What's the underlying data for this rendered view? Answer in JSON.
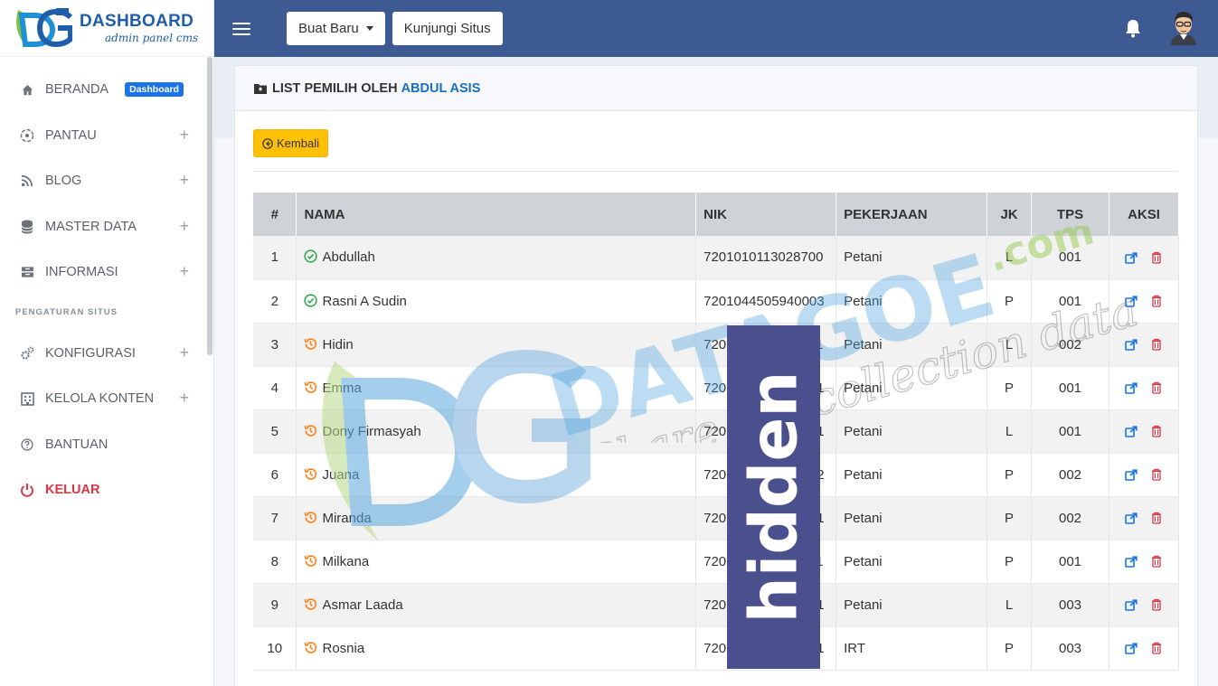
{
  "brand": {
    "title": "DASHBOARD",
    "subtitle": "admin panel cms"
  },
  "sidebar": {
    "items": [
      {
        "label": "BERANDA",
        "badge": "Dashboard"
      },
      {
        "label": "PANTAU"
      },
      {
        "label": "BLOG"
      },
      {
        "label": "MASTER DATA"
      },
      {
        "label": "INFORMASI"
      },
      {
        "label": "KONFIGURASI"
      },
      {
        "label": "KELOLA KONTEN"
      },
      {
        "label": "BANTUAN"
      },
      {
        "label": "KELUAR"
      }
    ],
    "section_label": "PENGATURAN SITUS",
    "expand_symbol": "+"
  },
  "topbar": {
    "create_label": "Buat Baru",
    "visit_label": "Kunjungi Situs"
  },
  "card": {
    "title_prefix": "LIST PEMILIH OLEH",
    "title_name": "ABDUL ASIS",
    "back_label": "Kembali"
  },
  "table": {
    "headers": [
      "#",
      "NAMA",
      "NIK",
      "PEKERJAAN",
      "JK",
      "TPS",
      "AKSI"
    ],
    "rows": [
      {
        "no": "1",
        "name": "Abdullah",
        "status": "verified",
        "nik": "7201010113028700",
        "job": "Petani",
        "jk": "L",
        "tps": "001"
      },
      {
        "no": "2",
        "name": "Rasni A Sudin",
        "status": "verified",
        "nik": "7201044505940003",
        "job": "Petani",
        "jk": "P",
        "tps": "001"
      },
      {
        "no": "3",
        "name": "Hidin",
        "status": "pending",
        "nik": "7201011008700001",
        "job": "Petani",
        "jk": "L",
        "tps": "002"
      },
      {
        "no": "4",
        "name": "Emma",
        "status": "pending",
        "nik": "7201015566700001",
        "job": "Petani",
        "jk": "P",
        "tps": "001"
      },
      {
        "no": "5",
        "name": "Dony Firmasyah",
        "status": "pending",
        "nik": "7201013000000001",
        "job": "Petani",
        "jk": "L",
        "tps": "001"
      },
      {
        "no": "6",
        "name": "Juana",
        "status": "pending",
        "nik": "7201015000000002",
        "job": "Petani",
        "jk": "P",
        "tps": "002"
      },
      {
        "no": "7",
        "name": "Miranda",
        "status": "pending",
        "nik": "7201017000000001",
        "job": "Petani",
        "jk": "P",
        "tps": "002"
      },
      {
        "no": "8",
        "name": "Milkana",
        "status": "pending",
        "nik": "7201015711000001",
        "job": "Petani",
        "jk": "P",
        "tps": "001"
      },
      {
        "no": "9",
        "name": "Asmar Laada",
        "status": "pending",
        "nik": "7201012008770001",
        "job": "Petani",
        "jk": "L",
        "tps": "003"
      },
      {
        "no": "10",
        "name": "Rosnia",
        "status": "pending",
        "nik": "7201036346800001",
        "job": "IRT",
        "jk": "P",
        "tps": "003"
      }
    ]
  },
  "watermark": {
    "brand": "DATAGOE",
    "domain": ".com",
    "tagline": "Share my collection data",
    "stamp": "hidden"
  },
  "colors": {
    "topbar": "#3d5a93",
    "primary": "#1a73e8",
    "danger": "#dc3545",
    "warning": "#ffc107",
    "success": "#28a745",
    "pending": "#fd7e14"
  }
}
